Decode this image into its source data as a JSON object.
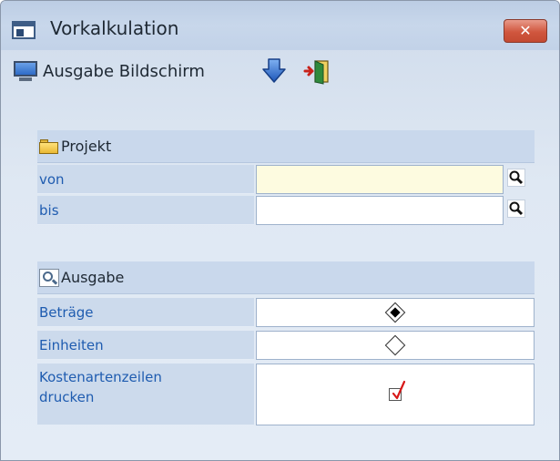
{
  "window": {
    "title": "Vorkalkulation",
    "close_label": "✕"
  },
  "toolbar": {
    "output_label": "Ausgabe Bildschirm",
    "output_icon": "monitor-icon",
    "download_icon": "arrow-down-icon",
    "exit_icon": "exit-door-icon"
  },
  "projekt": {
    "header": "Projekt",
    "icon": "folder-icon",
    "rows": [
      {
        "label": "von",
        "value": ""
      },
      {
        "label": "bis",
        "value": ""
      }
    ]
  },
  "ausgabe": {
    "header": "Ausgabe",
    "icon": "magnifier-icon",
    "betraege_label": "Beträge",
    "betraege_selected": true,
    "einheiten_label": "Einheiten",
    "einheiten_selected": false,
    "kostenarten_label": "Kostenartenzeilen drucken",
    "kostenarten_checked": true
  },
  "colors": {
    "label_text": "#1f5cb0",
    "section_bg": "#c9d8ec",
    "focused_field": "#fdfbe0",
    "close_button": "#d0563e",
    "check_mark": "#d81818"
  }
}
